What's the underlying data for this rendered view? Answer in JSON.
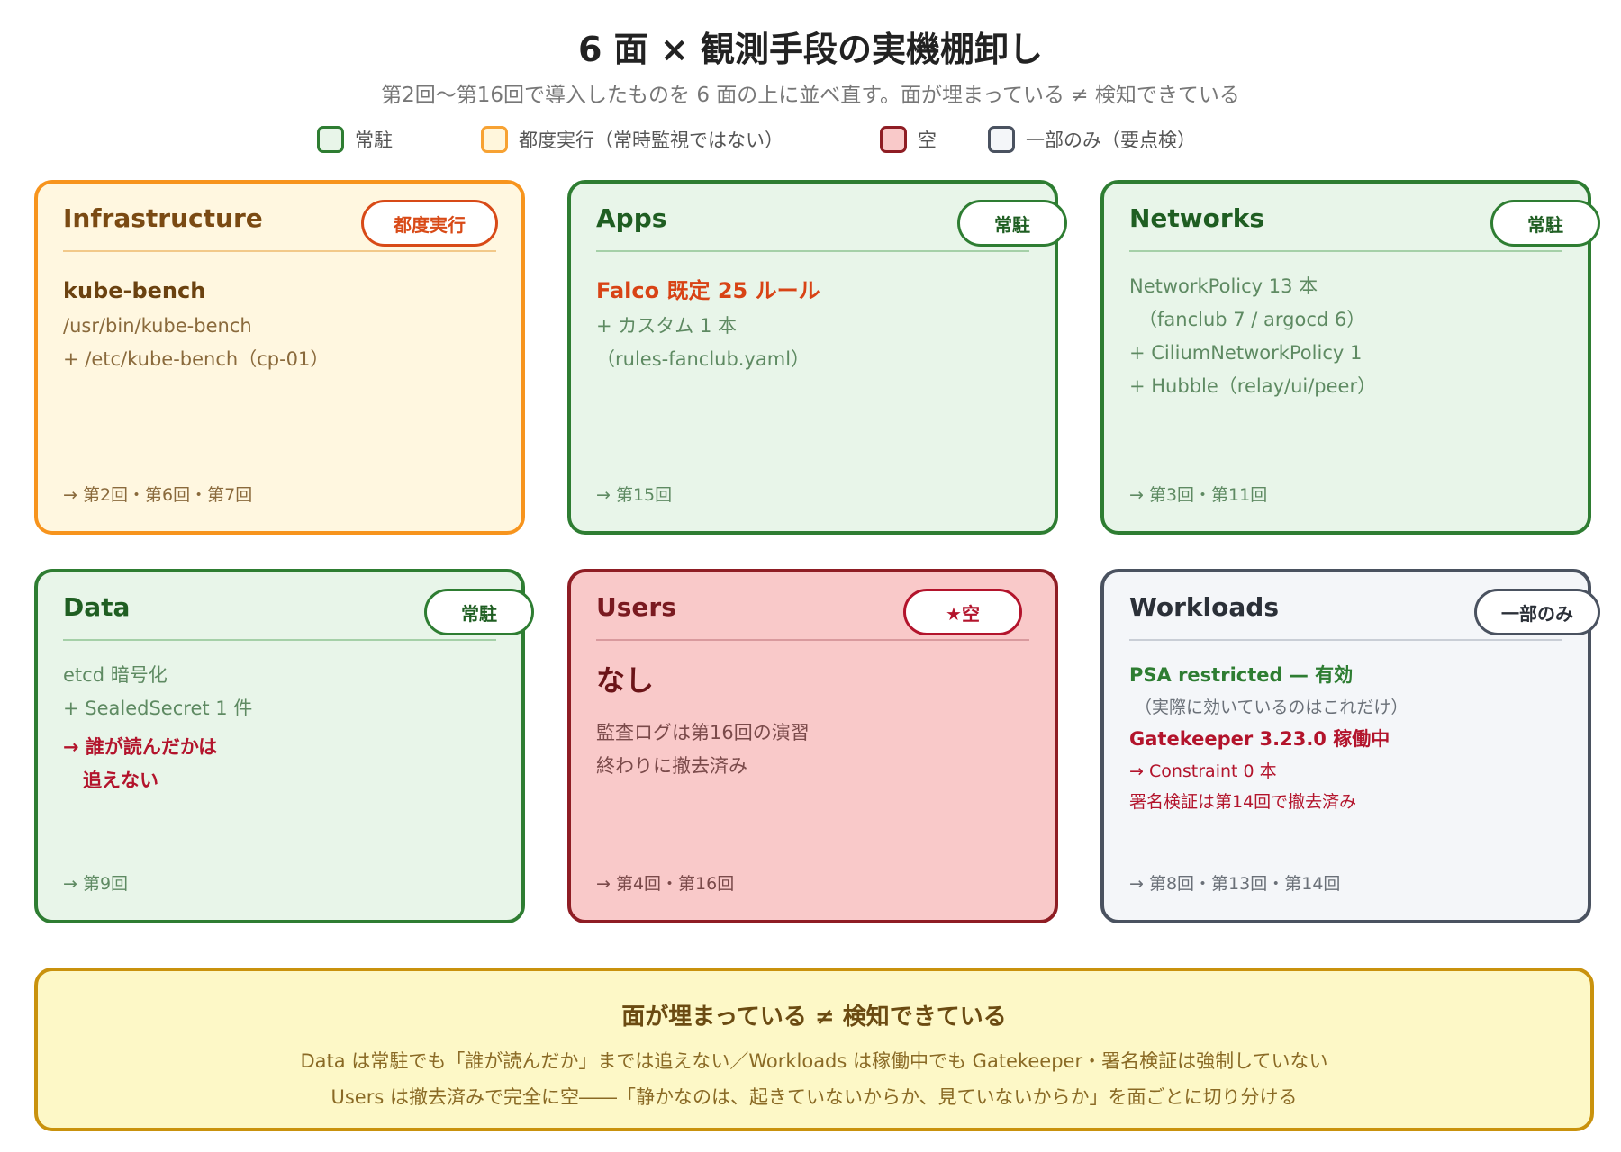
{
  "header": {
    "title": "6 面 × 観測手段の実機棚卸し",
    "subtitle": "第2回〜第16回で導入したものを 6 面の上に並べ直す。面が埋まっている ≠ 検知できている"
  },
  "legend": [
    {
      "label": "常駐",
      "color": "#2e7d32",
      "fill": "#e8f5e9"
    },
    {
      "label": "都度実行（常時監視ではない）",
      "color": "#f7a233",
      "fill": "#fff6dc"
    },
    {
      "label": "空",
      "color": "#8f1d24",
      "fill": "#f9c9c9"
    },
    {
      "label": "一部のみ（要点検）",
      "color": "#4a5260",
      "fill": "#f4f6f9"
    }
  ],
  "cards": [
    {
      "title": "Infrastructure",
      "badge": "都度実行",
      "lines": [
        "kube-bench",
        "/usr/bin/kube-bench",
        "+ /etc/kube-bench（cp-01）"
      ],
      "footer": "→ 第2回・第6回・第7回",
      "colors": {
        "border": "#f7941d",
        "bg": "#fff7e0",
        "title": "#7a4a13",
        "rule": "#f2c98a",
        "badge": "#d84a17",
        "badge_border": "#d84a17",
        "text": "#8a6a3c",
        "strong": "#6b4210"
      }
    },
    {
      "title": "Apps",
      "badge": "常駐",
      "lines": [
        "Falco 既定 25 ルール",
        "+ カスタム 1 本",
        "（rules-fanclub.yaml）"
      ],
      "footer": "→ 第15回",
      "colors": {
        "border": "#2e7d32",
        "bg": "#e8f5e9",
        "title": "#1f5e22",
        "rule": "#a5d0a8",
        "badge": "#1f5e22",
        "badge_border": "#2e7d32",
        "text": "#5e8a62",
        "strong": "#d84315"
      }
    },
    {
      "title": "Networks",
      "badge": "常駐",
      "lines": [
        "NetworkPolicy 13 本",
        "（fanclub 7 / argocd 6）",
        "+ CiliumNetworkPolicy 1",
        "+ Hubble（relay/ui/peer）"
      ],
      "footer": "→ 第3回・第11回",
      "colors": {
        "border": "#2e7d32",
        "bg": "#e8f5e9",
        "title": "#1f5e22",
        "rule": "#a5d0a8",
        "badge": "#1f5e22",
        "badge_border": "#2e7d32",
        "text": "#5e8a62",
        "strong": "#5e8a62"
      }
    },
    {
      "title": "Data",
      "badge": "常駐",
      "lines": [
        "etcd 暗号化",
        "+ SealedSecret 1 件",
        "→ 誰が読んだかは",
        "追えない"
      ],
      "footer": "→ 第9回",
      "colors": {
        "border": "#2e7d32",
        "bg": "#e8f5e9",
        "title": "#1f5e22",
        "rule": "#a5d0a8",
        "badge": "#1f5e22",
        "badge_border": "#2e7d32",
        "text": "#5e8a62",
        "strong": "#b3142c"
      }
    },
    {
      "title": "Users",
      "badge": "★空",
      "lines": [
        "なし",
        "監査ログは第16回の演習",
        "終わりに撤去済み"
      ],
      "footer": "→ 第4回・第16回",
      "colors": {
        "border": "#8f1d24",
        "bg": "#f9c9c9",
        "title": "#7a1a20",
        "rule": "#d99a9e",
        "badge": "#b3142c",
        "badge_border": "#b3142c",
        "text": "#7a4a4a",
        "strong": "#6b1418"
      }
    },
    {
      "title": "Workloads",
      "badge": "一部のみ",
      "lines": [
        "PSA restricted — 有効",
        "（実際に効いているのはこれだけ）",
        "Gatekeeper 3.23.0 稼働中",
        "→ Constraint 0 本",
        "署名検証は第14回で撤去済み"
      ],
      "footer": "→ 第8回・第13回・第14回",
      "colors": {
        "border": "#4a5260",
        "bg": "#f4f6f9",
        "title": "#2b3038",
        "rule": "#c9ced6",
        "badge": "#2b3038",
        "badge_border": "#4a5260",
        "text": "#6a7078",
        "strong": "#2e7d32"
      }
    }
  ],
  "summary": {
    "title": "面が埋まっている ≠ 検知できている",
    "line1": "Data は常駐でも「誰が読んだか」までは追えない／Workloads は稼働中でも Gatekeeper・署名検証は強制していない",
    "line2": "Users は撤去済みで完全に空――「静かなのは、起きていないからか、見ていないからか」を面ごとに切り分ける"
  }
}
